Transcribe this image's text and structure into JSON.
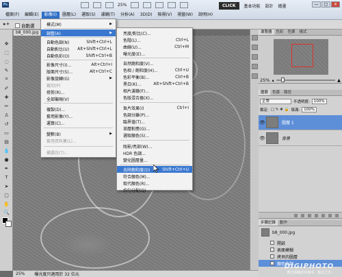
{
  "app": {
    "logo": "Ps",
    "zoom": "25%"
  },
  "menubar": [
    "檔案(F)",
    "編輯(E)",
    "影像(I)",
    "圖層(L)",
    "選取(S)",
    "濾鏡(T)",
    "分析(A)",
    "3D(D)",
    "檢視(V)",
    "視窗(W)",
    "說明(H)"
  ],
  "workspace": {
    "click": "CLICK",
    "items": [
      "基本功能",
      "設計",
      "繪畫"
    ]
  },
  "window_controls": [
    "—",
    "□",
    "✕"
  ],
  "options": {
    "autoselect": "自動選"
  },
  "document": {
    "tab": "b8_000.jpg"
  },
  "image_menu": [
    {
      "label": "模式(M)",
      "shortcut": "",
      "submenu": true
    },
    {
      "label": "調整(A)",
      "shortcut": "",
      "submenu": true,
      "highlight": true
    },
    {
      "label": "自動色調(N)",
      "shortcut": "Shift+Ctrl+L"
    },
    {
      "label": "自動對比(U)",
      "shortcut": "Alt+Shift+Ctrl+L"
    },
    {
      "label": "自動色彩(O)",
      "shortcut": "Shift+Ctrl+B"
    },
    {
      "label": "影像尺寸(I)...",
      "shortcut": "Alt+Ctrl+I"
    },
    {
      "label": "版面尺寸(S)...",
      "shortcut": "Alt+Ctrl+C"
    },
    {
      "label": "影像旋轉(G)",
      "shortcut": "",
      "submenu": true
    },
    {
      "label": "裁切(P)",
      "shortcut": "",
      "disabled": true
    },
    {
      "label": "修剪(R)...",
      "shortcut": ""
    },
    {
      "label": "全部顯現(V)",
      "shortcut": ""
    },
    {
      "label": "複製(D)...",
      "shortcut": ""
    },
    {
      "label": "套用影像(Y)...",
      "shortcut": ""
    },
    {
      "label": "運算(C)...",
      "shortcut": ""
    },
    {
      "label": "變數(B)",
      "shortcut": "",
      "submenu": true
    },
    {
      "label": "套用資料集(L)...",
      "shortcut": "",
      "disabled": true
    },
    {
      "label": "補漏白(T)...",
      "shortcut": "",
      "disabled": true
    }
  ],
  "adjust_menu": [
    {
      "label": "亮度/對比(C)...",
      "shortcut": ""
    },
    {
      "label": "色階(L)...",
      "shortcut": "Ctrl+L"
    },
    {
      "label": "曲線(U)...",
      "shortcut": "Ctrl+M"
    },
    {
      "label": "曝光度(E)...",
      "shortcut": ""
    },
    {
      "label": "自然飽和度(V)...",
      "shortcut": ""
    },
    {
      "label": "色相 / 飽和度(H)...",
      "shortcut": "Ctrl+U"
    },
    {
      "label": "色彩平衡(B)...",
      "shortcut": "Ctrl+B"
    },
    {
      "label": "黑白(K)...",
      "shortcut": "Alt+Shift+Ctrl+B"
    },
    {
      "label": "相片濾鏡(F)...",
      "shortcut": ""
    },
    {
      "label": "色版混合器(X)...",
      "shortcut": ""
    },
    {
      "label": "負片效果(I)",
      "shortcut": "Ctrl+I"
    },
    {
      "label": "色調分離(P)...",
      "shortcut": ""
    },
    {
      "label": "臨界值(T)...",
      "shortcut": ""
    },
    {
      "label": "漸層對應(G)...",
      "shortcut": ""
    },
    {
      "label": "選取顏色(S)...",
      "shortcut": ""
    },
    {
      "label": "陰影/亮部(W)...",
      "shortcut": ""
    },
    {
      "label": "HDR 色調...",
      "shortcut": ""
    },
    {
      "label": "變化圖層量...",
      "shortcut": ""
    },
    {
      "label": "去除飽和度(D)",
      "shortcut": "Shift+Ctrl+U",
      "highlight": true
    },
    {
      "label": "符合顏色(M)...",
      "shortcut": ""
    },
    {
      "label": "取代顏色(R)...",
      "shortcut": ""
    },
    {
      "label": "均勻分配(Q)",
      "shortcut": ""
    }
  ],
  "navigator": {
    "tabs": [
      "導覽器",
      "色彩",
      "色票",
      "樣式"
    ],
    "zoom": "25%"
  },
  "layers": {
    "tabs": [
      "圖層",
      "色版",
      "路徑"
    ],
    "blend_mode": "正常",
    "opacity_label": "不透明度:",
    "opacity": "100%",
    "lock_label": "鎖定:",
    "fill_label": "填滿:",
    "fill": "100%",
    "items": [
      {
        "name": "圖層 1",
        "selected": true
      },
      {
        "name": "背景",
        "selected": false
      }
    ]
  },
  "history": {
    "tabs": [
      "步驟記錄",
      "動作"
    ],
    "snapshot": "b8_000.jpg",
    "items": [
      {
        "label": "開啟",
        "selected": false
      },
      {
        "label": "表面模糊",
        "selected": false
      },
      {
        "label": "拷貝的圖層",
        "selected": false
      },
      {
        "label": "顏色快調",
        "selected": true
      }
    ]
  },
  "status": {
    "zoom": "25%",
    "info": "曝光度只適用於 32 位元"
  },
  "watermark": {
    "logo": "DIGIPHOTO",
    "sub": "數位相機的好幫手 · 數位之光"
  }
}
